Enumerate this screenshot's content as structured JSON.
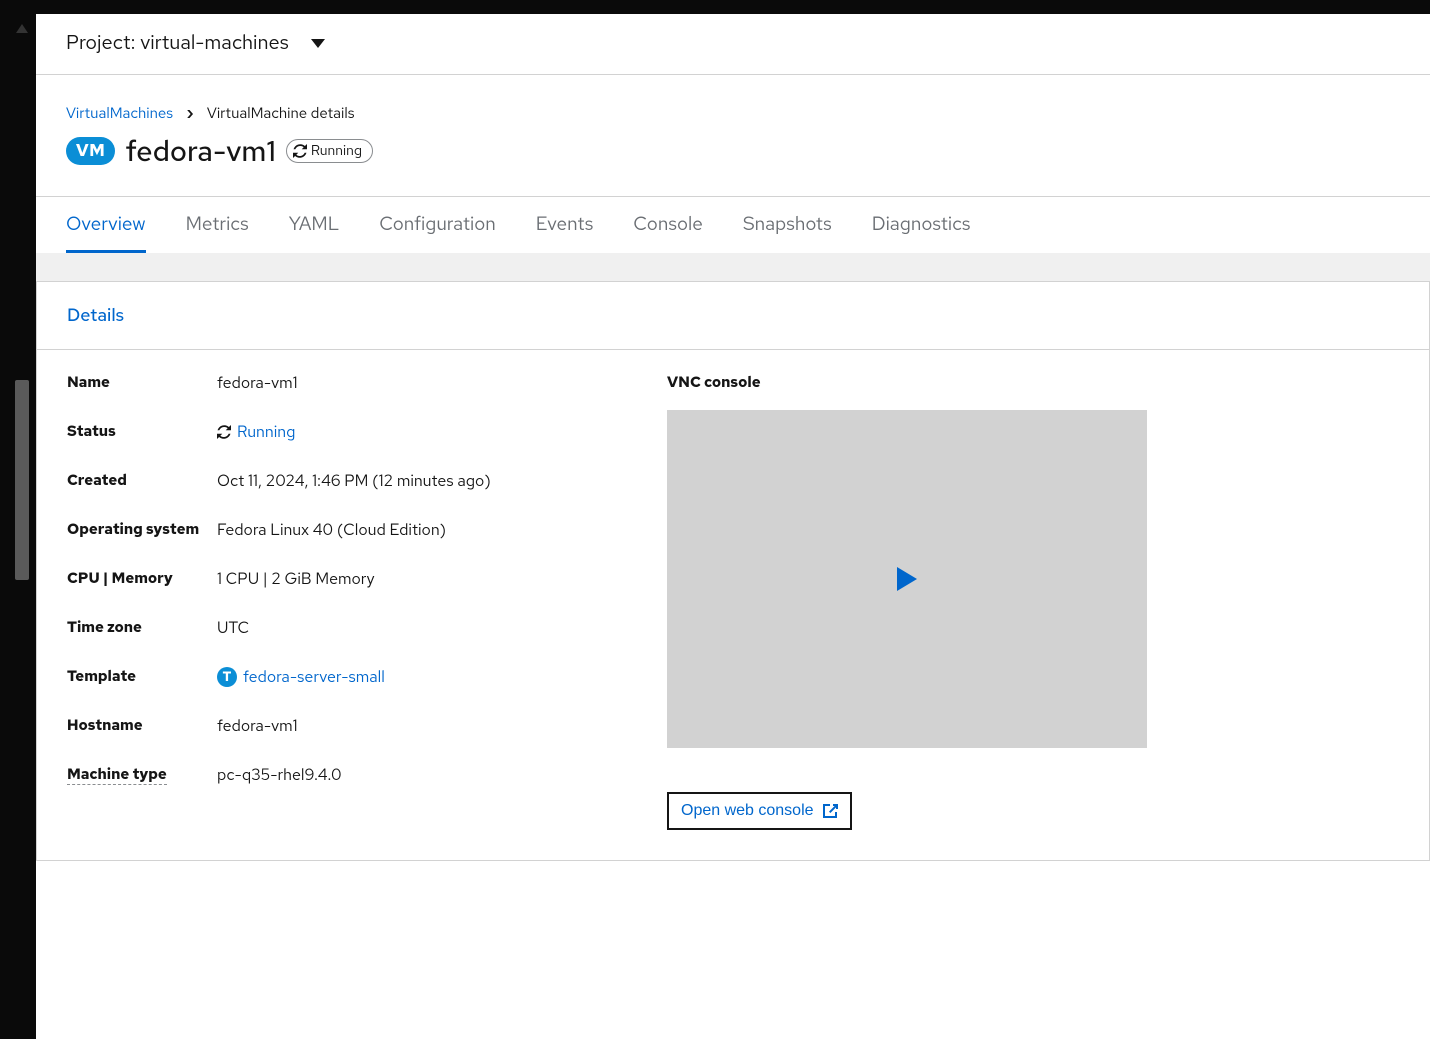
{
  "project": {
    "label": "Project: virtual-machines"
  },
  "breadcrumb": {
    "root": "VirtualMachines",
    "current": "VirtualMachine details"
  },
  "vm": {
    "badge": "VM",
    "name_title": "fedora-vm1",
    "status_pill": "Running"
  },
  "tabs": {
    "overview": "Overview",
    "metrics": "Metrics",
    "yaml": "YAML",
    "configuration": "Configuration",
    "events": "Events",
    "console": "Console",
    "snapshots": "Snapshots",
    "diagnostics": "Diagnostics"
  },
  "card": {
    "details_link": "Details"
  },
  "details": {
    "labels": {
      "name": "Name",
      "status": "Status",
      "created": "Created",
      "os": "Operating system",
      "cpu_mem": "CPU | Memory",
      "timezone": "Time zone",
      "template": "Template",
      "hostname": "Hostname",
      "machine_type": "Machine type"
    },
    "values": {
      "name": "fedora-vm1",
      "status": "Running",
      "created": "Oct 11, 2024, 1:46 PM (12 minutes ago)",
      "os": "Fedora Linux 40 (Cloud Edition)",
      "cpu_mem": "1 CPU | 2 GiB Memory",
      "timezone": "UTC",
      "template_badge": "T",
      "template": "fedora-server-small",
      "hostname": "fedora-vm1",
      "machine_type": "pc-q35-rhel9.4.0"
    }
  },
  "console": {
    "title": "VNC console",
    "open_button": "Open web console"
  },
  "colors": {
    "accent": "#0066cc",
    "badge": "#0b8ed6"
  }
}
